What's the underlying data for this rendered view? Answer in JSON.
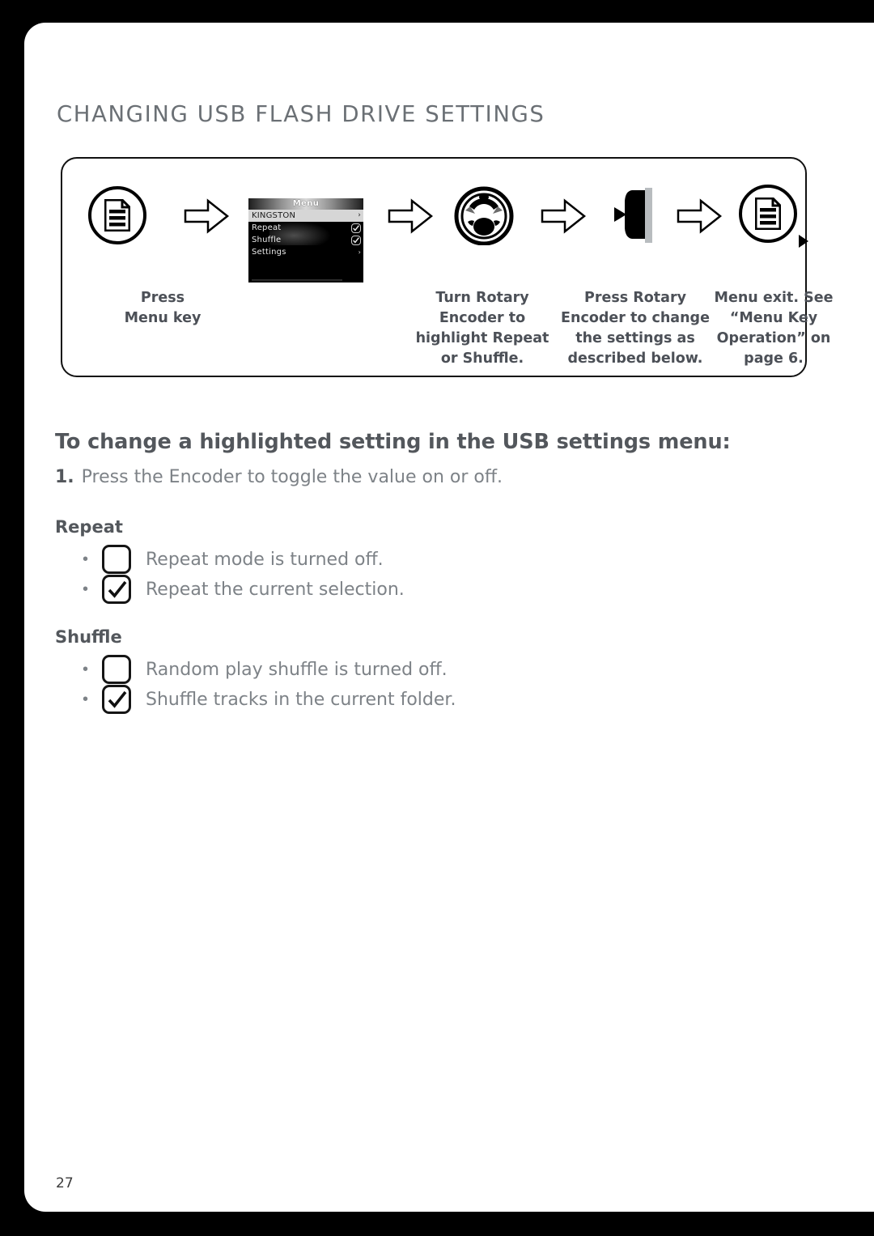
{
  "page": {
    "title": "CHANGING USB FLASH DRIVE SETTINGS",
    "number": "27"
  },
  "flow": {
    "steps": [
      {
        "icon": "menu-key-icon",
        "caption": "Press\nMenu key"
      },
      {
        "icon": "lcd-screen",
        "caption": ""
      },
      {
        "icon": "rotary-encoder-icon",
        "caption": "Turn Rotary\nEncoder to\nhighlight Repeat\nor Shuffle."
      },
      {
        "icon": "press-encoder-icon",
        "caption": "Press Rotary\nEncoder to change\nthe settings as\ndescribed below."
      },
      {
        "icon": "menu-key-exit-icon",
        "caption": "Menu exit. See\n“Menu Key\nOperation” on\npage 6."
      }
    ],
    "captions": {
      "press_menu_key": "Press\nMenu key",
      "turn_rotary": "Turn Rotary\nEncoder to\nhighlight Repeat\nor Shuffle.",
      "press_rotary": "Press Rotary\nEncoder to change\nthe settings as\ndescribed below.",
      "menu_exit": "Menu exit. See\n“Menu Key\nOperation” on\npage 6."
    },
    "arrow_glyph": "⇨"
  },
  "lcd": {
    "title": "Menu",
    "rows": [
      {
        "label": "KINGSTON",
        "control": "arrow",
        "selected": true
      },
      {
        "label": "Repeat",
        "control": "check",
        "selected": false
      },
      {
        "label": "Shuffle",
        "control": "check",
        "selected": false
      },
      {
        "label": "Settings",
        "control": "arrow-small",
        "selected": false
      }
    ],
    "arrow_glyph": "›"
  },
  "content": {
    "heading": "To change a highlighted setting in the USB settings menu:",
    "step_number": "1.",
    "step_text": "Press the Encoder to toggle the value on or off.",
    "groups": [
      {
        "title": "Repeat",
        "options": [
          {
            "checked": false,
            "label": "Repeat mode is turned off."
          },
          {
            "checked": true,
            "label": "Repeat the current selection."
          }
        ]
      },
      {
        "title": "Shuffle",
        "options": [
          {
            "checked": false,
            "label": "Random play shuffle is turned off."
          },
          {
            "checked": true,
            "label": "Shuffle tracks in the current folder."
          }
        ]
      }
    ],
    "bullet_glyph": "•"
  },
  "colors": {
    "page_background": "#ffffff",
    "outer_background": "#000000",
    "title_gray": "#6b7075",
    "body_gray": "#7d8287",
    "heading_gray": "#53575c",
    "caption_gray": "#4c5057",
    "ink_black": "#111111"
  }
}
